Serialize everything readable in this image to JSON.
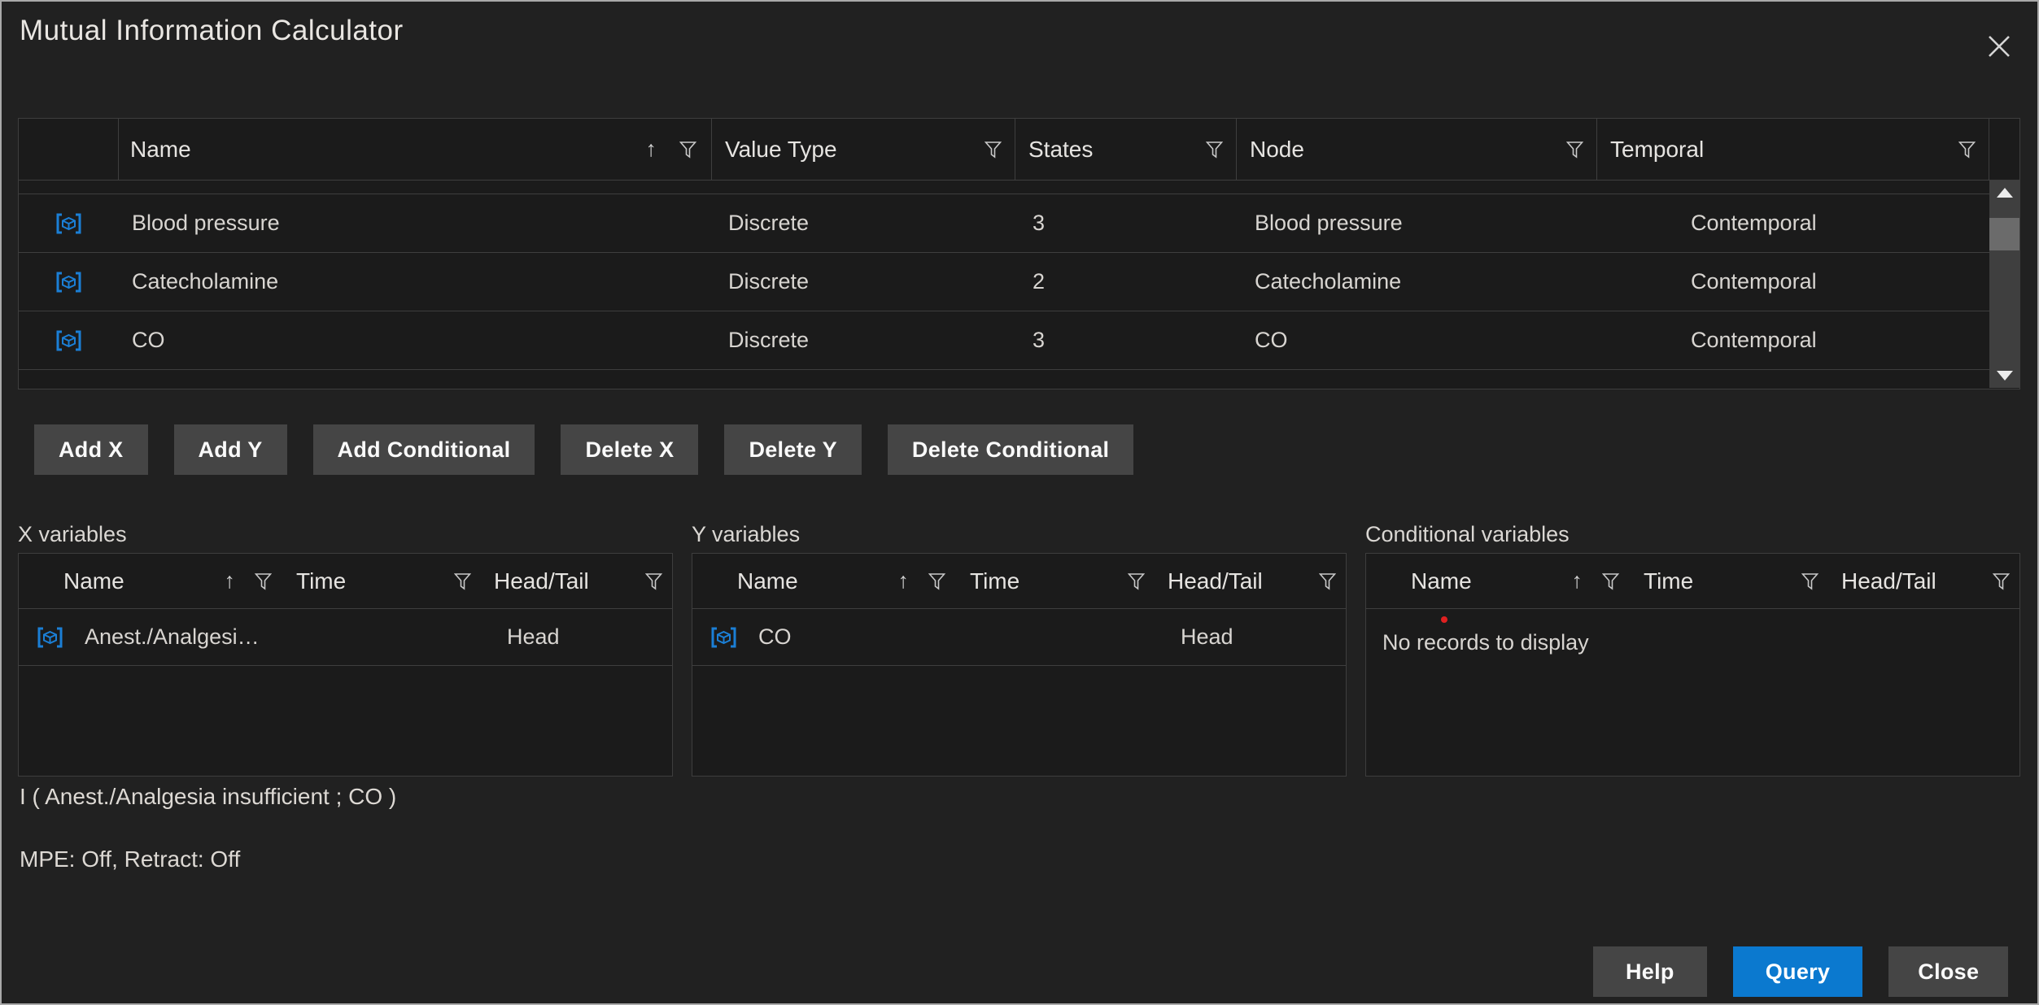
{
  "window": {
    "title": "Mutual Information Calculator"
  },
  "icons": {
    "close": "✕",
    "sort_ascending": "↑",
    "filter": "funnel",
    "node": "node-cube",
    "scroll_up": "▲",
    "scroll_down": "▼"
  },
  "colors": {
    "accent_blue": "#0b79cf",
    "node_icon_blue": "#1b7fd6",
    "red_dot": "#e02020",
    "button_gray": "#454545",
    "dialog_background": "#212121",
    "table_background": "#1b1b1b",
    "border_line": "#3e3e3e"
  },
  "main_table": {
    "columns": [
      "Name",
      "Value Type",
      "States",
      "Node",
      "Temporal"
    ],
    "rows": [
      {
        "name": "Blood pressure",
        "value_type": "Discrete",
        "states": "3",
        "node": "Blood pressure",
        "temporal": "Contemporal"
      },
      {
        "name": "Catecholamine",
        "value_type": "Discrete",
        "states": "2",
        "node": "Catecholamine",
        "temporal": "Contemporal"
      },
      {
        "name": "CO",
        "value_type": "Discrete",
        "states": "3",
        "node": "CO",
        "temporal": "Contemporal"
      }
    ]
  },
  "action_buttons": {
    "add_x": "Add X",
    "add_y": "Add Y",
    "add_conditional": "Add Conditional",
    "delete_x": "Delete X",
    "delete_y": "Delete Y",
    "delete_conditional": "Delete Conditional"
  },
  "variable_tables": {
    "x": {
      "label": "X variables",
      "columns": [
        "Name",
        "Time",
        "Head/Tail"
      ],
      "rows": [
        {
          "name": "Anest./Analgesi…",
          "time": "",
          "head_tail": "Head"
        }
      ]
    },
    "y": {
      "label": "Y variables",
      "columns": [
        "Name",
        "Time",
        "Head/Tail"
      ],
      "rows": [
        {
          "name": "CO",
          "time": "",
          "head_tail": "Head"
        }
      ]
    },
    "conditional": {
      "label": "Conditional variables",
      "columns": [
        "Name",
        "Time",
        "Head/Tail"
      ],
      "rows": [],
      "empty_text": "No records to display"
    }
  },
  "expression": "I ( Anest./Analgesia insufficient ; CO )",
  "status": "MPE: Off, Retract: Off",
  "footer_buttons": {
    "help": "Help",
    "query": "Query",
    "close": "Close"
  }
}
